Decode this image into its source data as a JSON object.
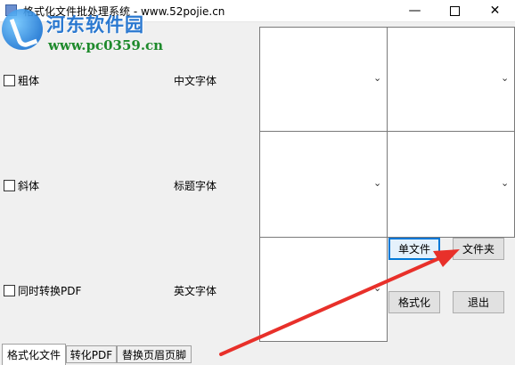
{
  "window": {
    "title": "格式化文件批处理系统 - www.52pojie.cn",
    "minimize_glyph": "—",
    "close_glyph": "✕"
  },
  "watermark": {
    "title": "河东软件园",
    "url": "www.pc0359.cn"
  },
  "options": {
    "bold_label": "粗体",
    "italic_label": "斜体",
    "convert_pdf_label": "同时转换PDF"
  },
  "fonts": {
    "chinese_font_label": "中文字体",
    "title_font_label": "标题字体",
    "english_font_label": "英文字体"
  },
  "buttons": {
    "single_file": "单文件",
    "folder": "文件夹",
    "format": "格式化",
    "exit": "退出"
  },
  "tabs": [
    {
      "label": "格式化文件",
      "active": true
    },
    {
      "label": "转化PDF",
      "active": false
    },
    {
      "label": "替换页眉页脚",
      "active": false
    }
  ],
  "icons": {
    "dropdown": "chevron-down-icon",
    "annotation": "red-arrow-annotation"
  },
  "colors": {
    "arrow": "#e8302a",
    "focus_border": "#0078d7",
    "watermark_blue": "#2a78d0",
    "watermark_green": "#1e8a2c"
  }
}
